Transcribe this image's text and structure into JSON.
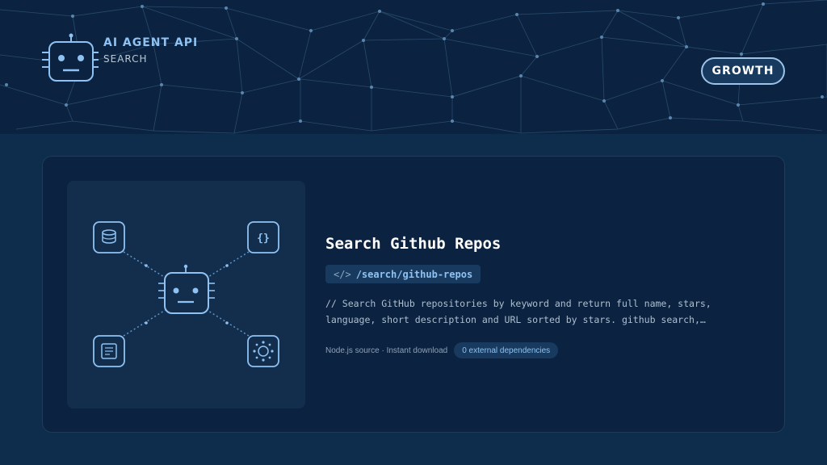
{
  "brand": {
    "title": "AI AGENT API",
    "subtitle": "SEARCH",
    "logo_icon": "robot-icon"
  },
  "header": {
    "growth_label": "GROWTH"
  },
  "card": {
    "title": "Search Github Repos",
    "endpoint_icon": "</>",
    "endpoint": "/search/github-repos",
    "description": "// Search GitHub repositories by keyword and return full name, stars, language, short description and URL sorted by stars. github search,…",
    "meta_text": "Node.js source · Instant download",
    "dependencies_badge": "0 external dependencies",
    "illustration_icons": [
      "database-icon",
      "code-braces-icon",
      "robot-icon",
      "document-icon",
      "network-hub-icon"
    ]
  },
  "colors": {
    "background": "#0e2c4b",
    "header_bg": "#0b2341",
    "accent": "#8fc2f2",
    "card_bg": "#0b2341"
  }
}
